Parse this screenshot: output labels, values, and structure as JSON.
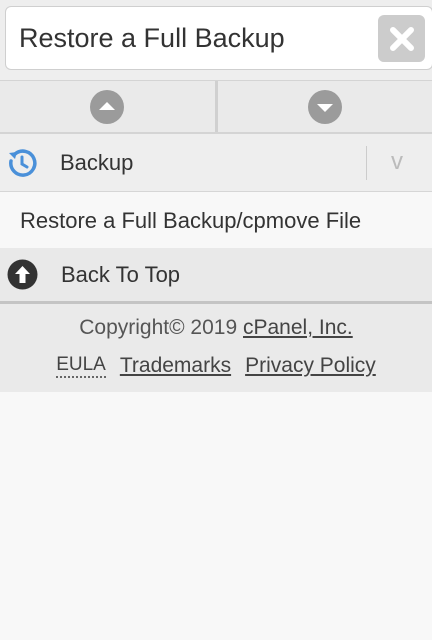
{
  "search": {
    "value": "Restore a Full Backup",
    "clear_icon": "close-x-icon"
  },
  "nav": {
    "up_icon": "circle-up-arrow-icon",
    "down_icon": "circle-down-arrow-icon"
  },
  "section": {
    "title": "Backup",
    "icon": "backup-clock-icon",
    "chevron": "v",
    "icon_color": "#4a90d9"
  },
  "results": [
    {
      "label": "Restore a Full Backup/cpmove File"
    }
  ],
  "back_to_top": {
    "label": "Back To Top",
    "icon": "up-arrow-circle-icon"
  },
  "footer": {
    "copyright_prefix": "Copyright© 2019",
    "company": "cPanel, Inc.",
    "links": [
      "EULA",
      "Trademarks",
      "Privacy Policy"
    ]
  }
}
